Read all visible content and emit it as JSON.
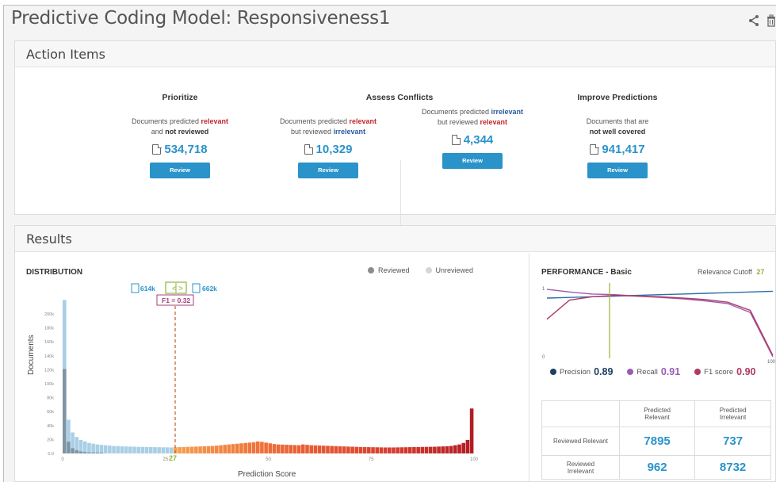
{
  "header": {
    "title": "Predictive Coding Model: Responsiveness1",
    "share_icon": "share-icon",
    "trash_icon": "trash-icon"
  },
  "action_items": {
    "heading": "Action Items",
    "columns": [
      {
        "title": "Prioritize",
        "line1a": "Documents predicted ",
        "line1b": "relevant",
        "line2a": "and ",
        "line2b": "not reviewed",
        "count": "534,718",
        "button": "Review"
      },
      {
        "title": "Assess Conflicts",
        "line1a": "Documents predicted ",
        "line1b": "relevant",
        "line2a": "but reviewed ",
        "line2b": "irrelevant",
        "count": "10,329",
        "button": "Review"
      },
      {
        "title": "",
        "line1a": "Documents predicted ",
        "line1b": "irrelevant",
        "line2a": "but reviewed ",
        "line2b": "relevant",
        "count": "4,344",
        "button": "Review"
      },
      {
        "title": "Improve Predictions",
        "line1a": "Documents that are",
        "line1b": "",
        "line2a": "",
        "line2b": "not well covered",
        "count": "941,417",
        "button": "Review"
      }
    ]
  },
  "results": {
    "heading": "Results",
    "distribution": {
      "label": "DISTRIBUTION",
      "legend_reviewed": "Reviewed",
      "legend_unreviewed": "Unreviewed",
      "left_count": "614k",
      "right_count": "662k",
      "f1_label": "F1 = 0.32",
      "cutoff_marker": "27",
      "y_axis_label": "Documents",
      "x_axis_label": "Prediction Score"
    },
    "performance": {
      "label": "PERFORMANCE - Basic",
      "cutoff_label": "Relevance Cutoff",
      "cutoff_value": "27",
      "metrics": [
        {
          "name": "Precision",
          "value": "0.89",
          "color": "#1d3f63"
        },
        {
          "name": "Recall",
          "value": "0.91",
          "color": "#9b5bb0"
        },
        {
          "name": "F1 score",
          "value": "0.90",
          "color": "#b03a64"
        }
      ],
      "table": {
        "col1": "Predicted Relevant",
        "col2": "Predicted Irrelevant",
        "rows": [
          {
            "label": "Reviewed Relevant",
            "a": "7895",
            "b": "737"
          },
          {
            "label": "Reviewed Irrelevant",
            "a": "962",
            "b": "8732"
          }
        ]
      }
    }
  },
  "chart_data": [
    {
      "type": "bar",
      "title": "DISTRIBUTION",
      "xlabel": "Prediction Score",
      "ylabel": "Documents",
      "x_ticks": [
        "0",
        "25",
        "50",
        "75",
        "100"
      ],
      "y_ticks": [
        "0.0",
        "20k",
        "40k",
        "60k",
        "80k",
        "100k",
        "120k",
        "140k",
        "160k",
        "180k",
        "200k"
      ],
      "ylim": [
        0,
        200000
      ],
      "xlim": [
        0,
        100
      ],
      "cutoff": 27,
      "series": [
        {
          "name": "Reviewed",
          "color": "#8ea0ad"
        },
        {
          "name": "Unreviewed",
          "color": "#a9cfe6"
        }
      ],
      "values": [
        205000,
        45000,
        28000,
        22000,
        18000,
        16000,
        14000,
        13000,
        12000,
        11500,
        11000,
        10500,
        10000,
        9800,
        9600,
        9400,
        9200,
        9000,
        8800,
        8700,
        8600,
        8500,
        8400,
        8300,
        8200,
        8100,
        8000,
        8200,
        8400,
        8600,
        8800,
        9000,
        9200,
        9400,
        9600,
        9800,
        10000,
        10500,
        11000,
        11500,
        12000,
        12500,
        13000,
        13500,
        14000,
        14500,
        15000,
        16000,
        15500,
        14500,
        13500,
        12500,
        12000,
        11800,
        11600,
        11400,
        11200,
        11000,
        12000,
        11500,
        11000,
        10800,
        10600,
        10400,
        10200,
        10000,
        9800,
        9600,
        9400,
        9200,
        9000,
        8800,
        8600,
        8500,
        8400,
        8300,
        8200,
        8100,
        8000,
        8000,
        8000,
        8100,
        8200,
        8300,
        8400,
        8500,
        8600,
        8700,
        8800,
        8900,
        9000,
        9200,
        9400,
        9600,
        10000,
        11000,
        12000,
        14000,
        18000,
        60000
      ],
      "reviewed_share": [
        0.55,
        0.35,
        0.25,
        0.2,
        0.15,
        0.12,
        0.1,
        0.1,
        0.1,
        0.1
      ]
    },
    {
      "type": "line",
      "title": "PERFORMANCE - Basic",
      "xlim": [
        0,
        100
      ],
      "ylim": [
        0,
        1
      ],
      "x_ticks": [
        "0",
        "100"
      ],
      "y_ticks": [
        "0",
        "1"
      ],
      "cutoff": 27,
      "series": [
        {
          "name": "Precision",
          "color": "#2b6ea6",
          "values": [
            0.86,
            0.87,
            0.88,
            0.89,
            0.9,
            0.91,
            0.92,
            0.93,
            0.94,
            0.95,
            0.96
          ]
        },
        {
          "name": "Recall",
          "color": "#9b5bb0",
          "values": [
            0.99,
            0.95,
            0.92,
            0.91,
            0.89,
            0.87,
            0.85,
            0.82,
            0.78,
            0.65,
            0.0
          ]
        },
        {
          "name": "F1 score",
          "color": "#b03a64",
          "values": [
            0.55,
            0.83,
            0.88,
            0.9,
            0.89,
            0.88,
            0.86,
            0.84,
            0.8,
            0.68,
            0.02
          ]
        }
      ]
    }
  ]
}
